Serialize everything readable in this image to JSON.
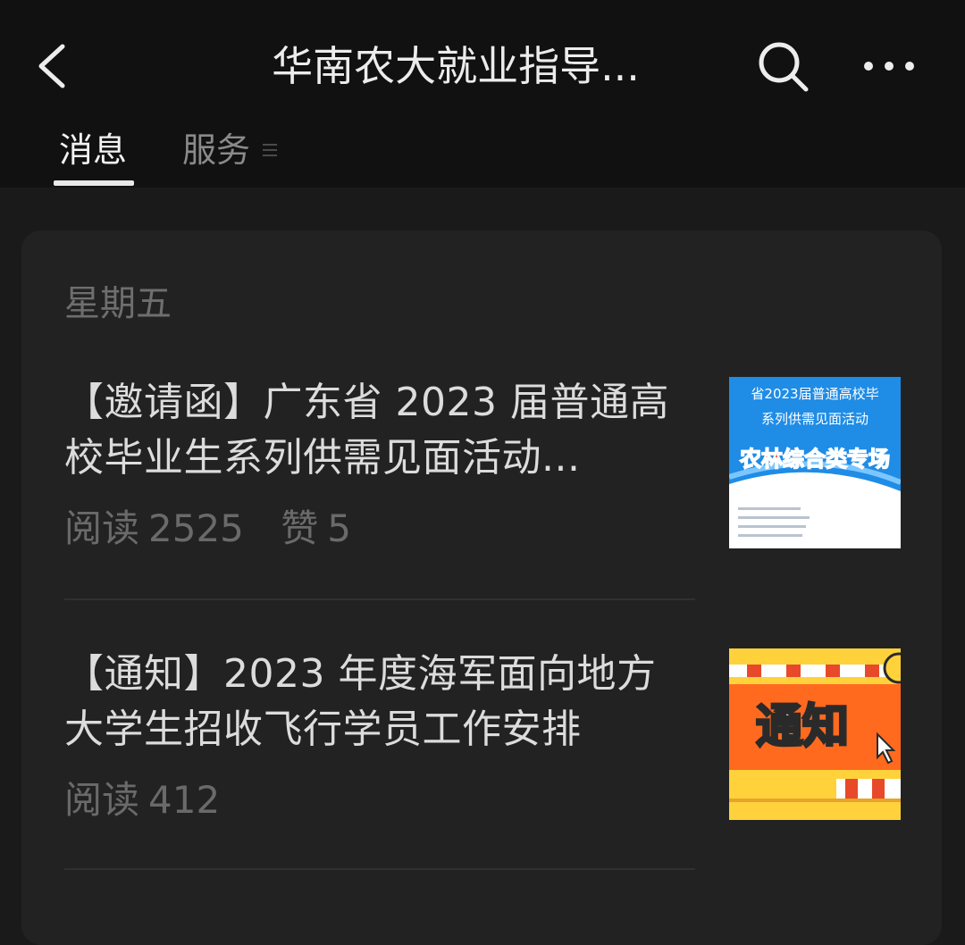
{
  "header": {
    "title": "华南农大就业指导...",
    "tabs": [
      {
        "label": "消息",
        "active": true
      },
      {
        "label": "服务",
        "active": false
      }
    ]
  },
  "feed": {
    "date": "星期五",
    "articles": [
      {
        "title": "【邀请函】广东省 2023 届普通高校毕业生系列供需见面活动...",
        "stats": {
          "reads_label": "阅读",
          "reads": "2525",
          "likes_label": "赞",
          "likes": "5"
        },
        "thumb": {
          "line1": "省2023届普通高校毕",
          "line2": "系列供需见面活动",
          "banner": "农林综合类专场",
          "colors": {
            "bg": "#1f8ce6",
            "banner_text": "#ff3b3b"
          }
        }
      },
      {
        "title": "【通知】2023 年度海军面向地方大学生招收飞行学员工作安排",
        "stats": {
          "reads_label": "阅读",
          "reads": "412"
        },
        "thumb": {
          "label": "通知",
          "colors": {
            "bg": "#ff6a1f",
            "accent": "#ffd23c"
          }
        }
      }
    ]
  },
  "colors": {
    "background": "#1a1a1a",
    "header": "#111111",
    "card": "#222222"
  }
}
